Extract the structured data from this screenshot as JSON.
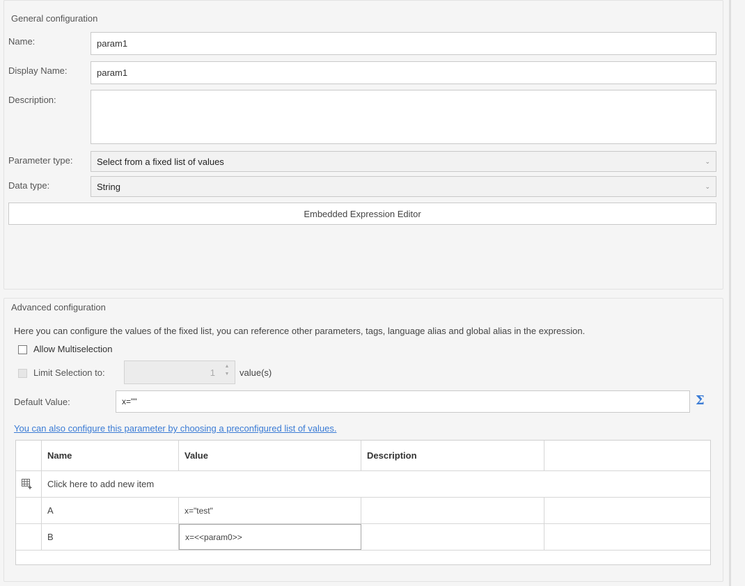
{
  "general": {
    "title": "General configuration",
    "name_label": "Name:",
    "name_value": "param1",
    "display_name_label": "Display Name:",
    "display_name_value": "param1",
    "description_label": "Description:",
    "description_value": "",
    "parameter_type_label": "Parameter type:",
    "parameter_type_value": "Select from a fixed list of values",
    "data_type_label": "Data type:",
    "data_type_value": "String",
    "embedded_editor_label": "Embedded Expression Editor"
  },
  "advanced": {
    "title": "Advanced configuration",
    "help_text": "Here you can configure the values of the fixed list, you can reference other parameters, tags, language alias and global alias in the expression.",
    "allow_multiselection_label": "Allow Multiselection",
    "allow_multiselection_checked": false,
    "limit_selection_label": "Limit Selection to:",
    "limit_selection_value": "1",
    "limit_selection_unit": "value(s)",
    "default_value_label": "Default Value:",
    "default_value": "x=\"\"",
    "sigma_icon": "Σ",
    "preconfigured_link": "You can also configure this parameter by choosing a preconfigured list of values."
  },
  "grid": {
    "columns": [
      "Name",
      "Value",
      "Description",
      ""
    ],
    "add_row_label": "Click here to add new item",
    "rows": [
      {
        "name": "A",
        "value": "x=\"test\"",
        "description": ""
      },
      {
        "name": "B",
        "value": "x=<<param0>>",
        "description": ""
      }
    ]
  },
  "icons": {
    "chevron": "chevron-down-icon",
    "sigma": "sigma-icon",
    "add_row": "add-row-icon",
    "spin_up": "▲",
    "spin_down": "▼",
    "dropdown_glyph": "⌄"
  },
  "colors": {
    "link": "#3a7bd5",
    "background": "#f5f5f5"
  }
}
